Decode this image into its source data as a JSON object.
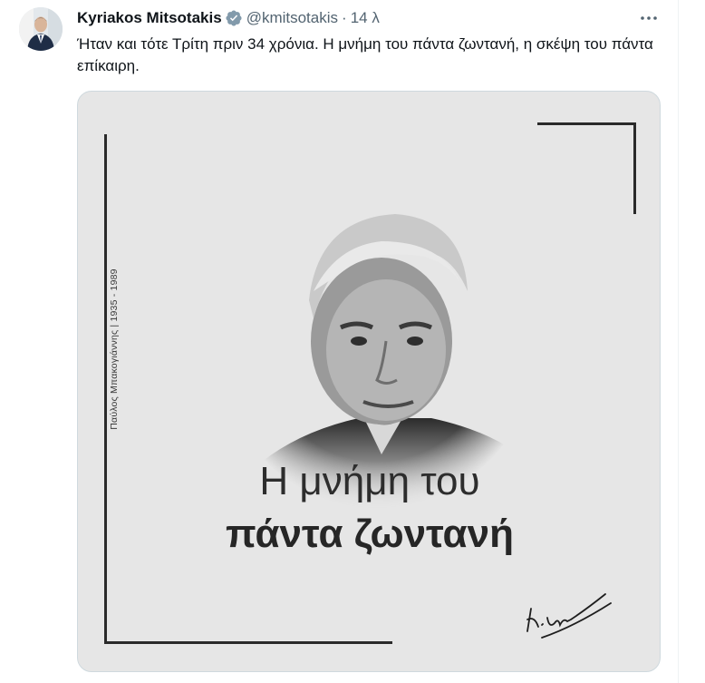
{
  "tweet": {
    "author_name": "Kyriakos Mitsotakis",
    "handle": "@kmitsotakis",
    "separator": "·",
    "time": "14 λ",
    "text": "Ήταν και τότε Τρίτη πριν 34 χρόνια. Η μνήμη του πάντα ζωντανή, η σκέψη του πάντα επίκαιρη.",
    "verified_icon": "verified-badge-icon",
    "more_icon": "more-horizontal-icon"
  },
  "media": {
    "vertical_caption": "Παύλος Μπακογιάννης | 1935 - 1989",
    "headline_line1": "Η μνήμη του",
    "headline_line2": "πάντα ζωντανή",
    "signature_icon": "signature-icon",
    "portrait_icon": "portrait-photo-icon",
    "background_color": "#e6e6e6"
  },
  "colors": {
    "verified": "#829aab",
    "secondary_text": "#536471",
    "primary_text": "#0f1419"
  }
}
